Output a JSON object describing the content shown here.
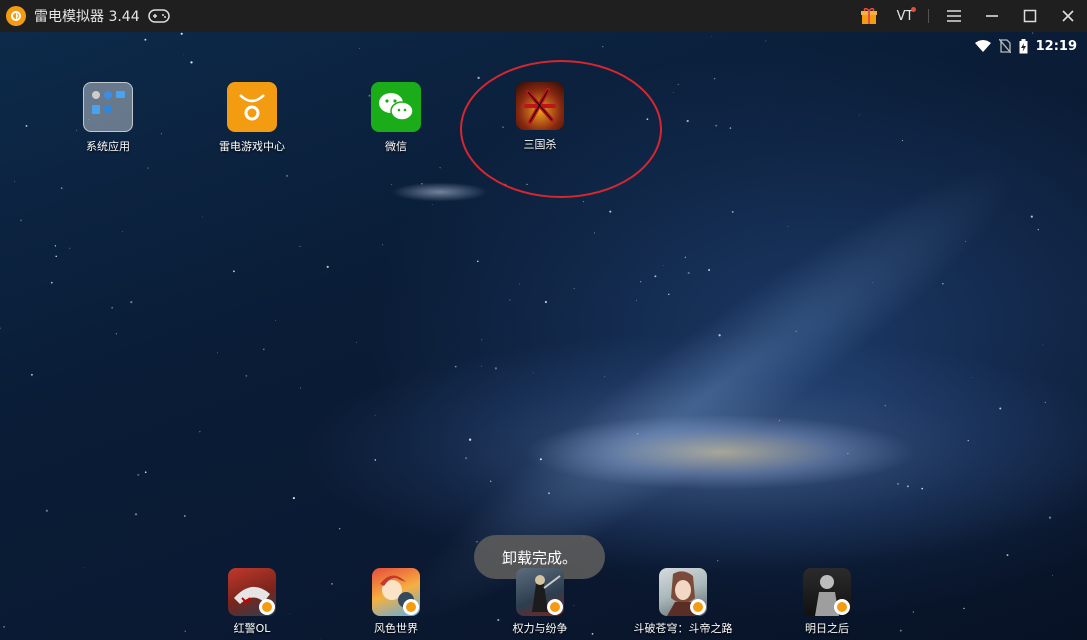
{
  "window": {
    "title": "雷电模拟器 3.44",
    "buttons": [
      "gift-icon",
      "vt-indicator",
      "menu-icon",
      "minimize-icon",
      "maximize-icon",
      "close-icon"
    ],
    "vt_label": "VT"
  },
  "status_bar": {
    "time": "12:19",
    "icons": [
      "wifi-icon",
      "no-sim-icon",
      "battery-charging-icon"
    ]
  },
  "desktop_icons": [
    {
      "label": "系统应用",
      "icon": "system-apps-folder-icon"
    },
    {
      "label": "雷电游戏中心",
      "icon": "leidian-game-center-icon"
    },
    {
      "label": "微信",
      "icon": "wechat-icon"
    },
    {
      "label": "三国杀",
      "icon": "sanguosha-icon"
    }
  ],
  "toast": {
    "text": "卸载完成。"
  },
  "dock_icons": [
    {
      "label": "红警OL",
      "icon": "hongjing-ol-icon"
    },
    {
      "label": "风色世界",
      "icon": "fengse-shijie-icon"
    },
    {
      "label": "权力与纷争",
      "icon": "quanli-yu-fenzheng-icon"
    },
    {
      "label": "斗破苍穹：斗帝之路",
      "icon": "doupo-cangqiong-icon"
    },
    {
      "label": "明日之后",
      "icon": "mingri-zhihou-icon"
    }
  ],
  "colors": {
    "titlebar": "#1f1f1f",
    "accent": "#f39c12",
    "annotation": "#d8262f",
    "wechat": "#1aad19"
  }
}
